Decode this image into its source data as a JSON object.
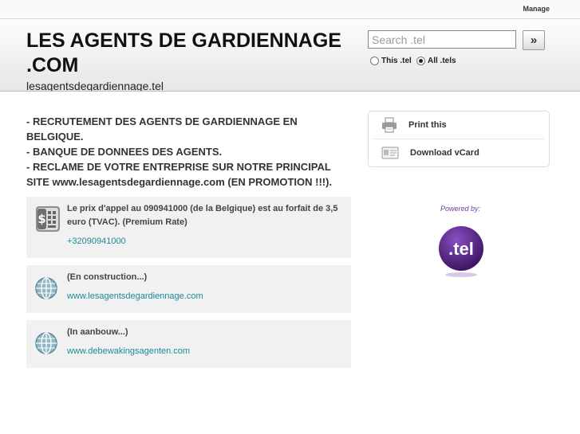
{
  "topbar": {
    "manage_label": "Manage"
  },
  "header": {
    "title_line1": "LES AGENTS DE GARDIENNAGE",
    "title_line2": ".COM",
    "subdomain": "lesagentsdegardiennage.tel"
  },
  "search": {
    "placeholder": "Search .tel",
    "value": "",
    "button_label": "»",
    "scope_this": "This .tel",
    "scope_all": "All .tels",
    "selected_scope": "All .tels"
  },
  "description": {
    "lines": [
      "- RECRUTEMENT DES AGENTS DE GARDIENNAGE EN BELGIQUE.",
      "- BANQUE DE DONNEES DES AGENTS.",
      "- RECLAME DE VOTRE ENTREPRISE SUR NOTRE PRINCIPAL SITE www.lesagentsdegardiennage.com (EN PROMOTION !!!)."
    ]
  },
  "cards": [
    {
      "icon": "premium-phone-icon",
      "text": "Le prix d'appel au 090941000 (de la Belgique) est au forfait de 3,5 euro (TVAC). (Premium Rate)",
      "link": "+32090941000"
    },
    {
      "icon": "globe-icon",
      "text": "(En construction...)",
      "link": "www.lesagentsdegardiennage.com"
    },
    {
      "icon": "globe-icon",
      "text": "(In aanbouw...)",
      "link": "www.debewakingsagenten.com"
    }
  ],
  "sidebar": {
    "print_label": "Print this",
    "vcard_label": "Download vCard"
  },
  "powered": {
    "label": "Powered by:",
    "logo_text": ".tel"
  },
  "colors": {
    "link": "#1a8a9a",
    "powered": "#6a3e9a",
    "logo": "#5b2a86"
  }
}
